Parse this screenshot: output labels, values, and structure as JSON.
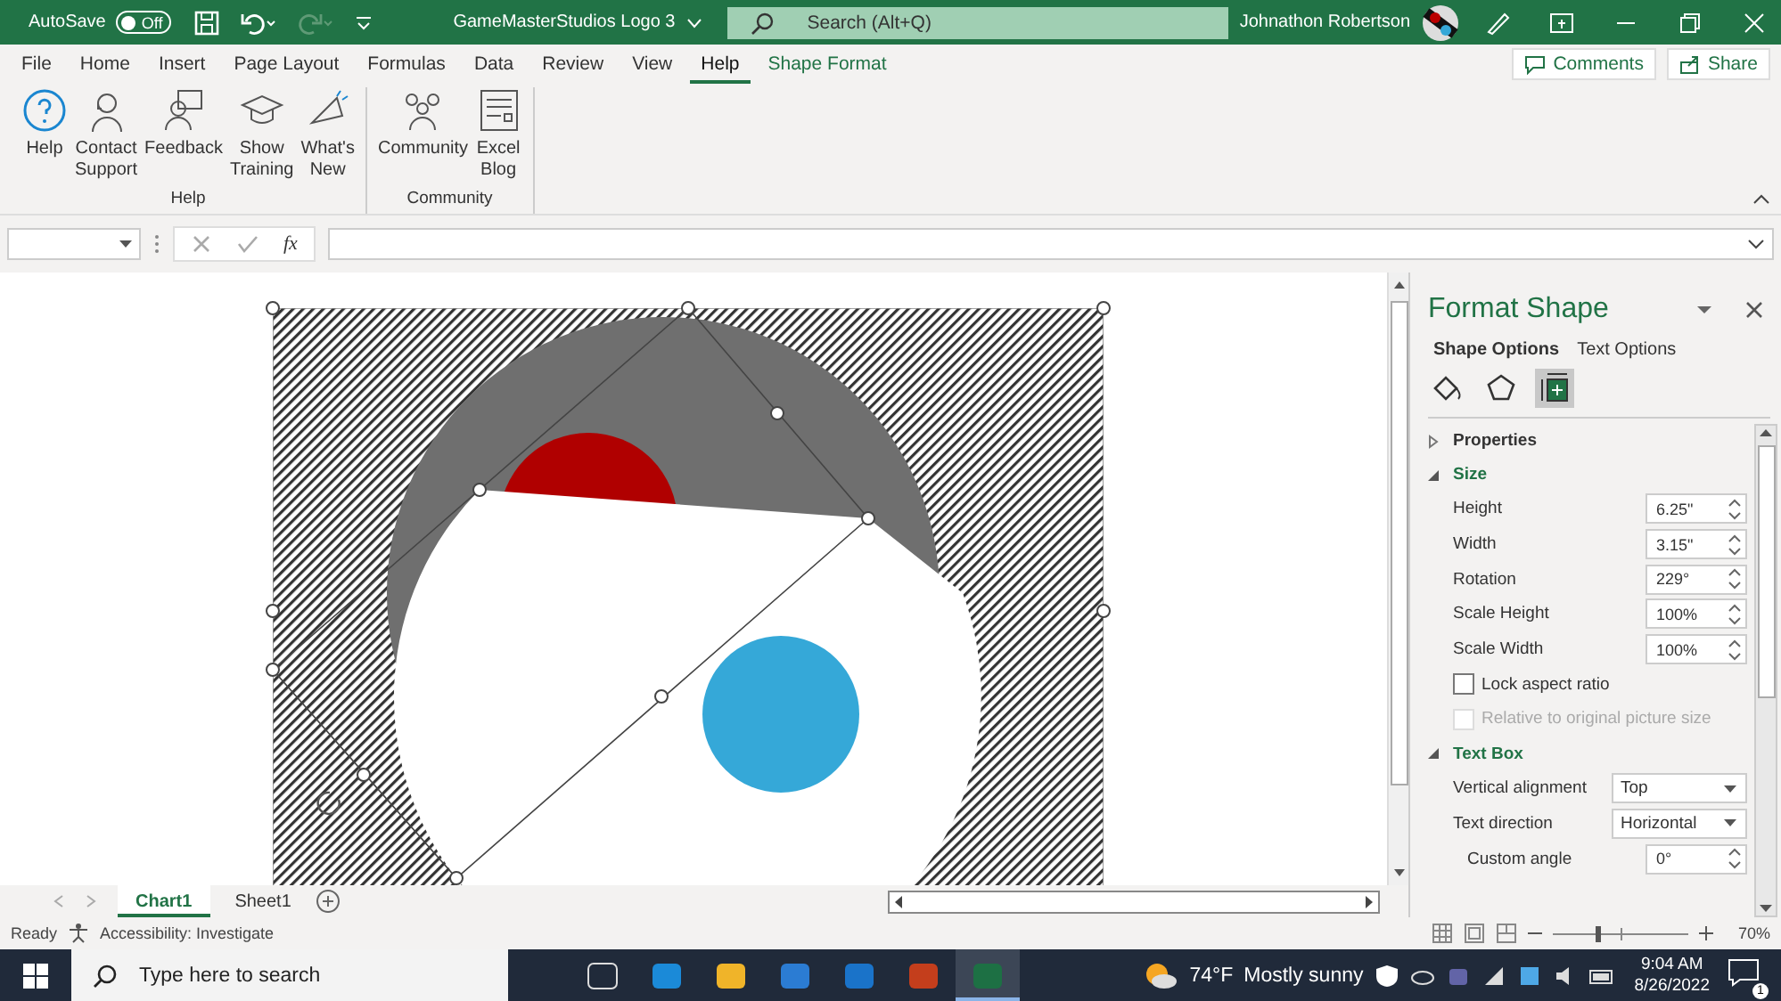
{
  "title_bar": {
    "autosave_label": "AutoSave",
    "autosave_toggle": {
      "label": "Off",
      "on": false
    },
    "document_title": "GameMasterStudios Logo 3",
    "search": {
      "placeholder": "Search (Alt+Q)"
    },
    "user_name": "Johnathon Robertson"
  },
  "ribbon_tabs": [
    {
      "label": "File",
      "selected": false,
      "kind": "standard"
    },
    {
      "label": "Home",
      "selected": false,
      "kind": "standard"
    },
    {
      "label": "Insert",
      "selected": false,
      "kind": "standard"
    },
    {
      "label": "Page Layout",
      "selected": false,
      "kind": "standard"
    },
    {
      "label": "Formulas",
      "selected": false,
      "kind": "standard"
    },
    {
      "label": "Data",
      "selected": false,
      "kind": "standard"
    },
    {
      "label": "Review",
      "selected": false,
      "kind": "standard"
    },
    {
      "label": "View",
      "selected": false,
      "kind": "standard"
    },
    {
      "label": "Help",
      "selected": true,
      "kind": "standard"
    },
    {
      "label": "Shape Format",
      "selected": false,
      "kind": "contextual"
    }
  ],
  "ribbon_actions": [
    "Comments",
    "Share"
  ],
  "ribbon_groups": [
    {
      "name": "Help",
      "buttons": [
        {
          "lines": [
            "Help"
          ]
        },
        {
          "lines": [
            "Contact",
            "Support"
          ]
        },
        {
          "lines": [
            "Feedback"
          ]
        },
        {
          "lines": [
            "Show",
            "Training"
          ]
        },
        {
          "lines": [
            "What's",
            "New"
          ]
        }
      ]
    },
    {
      "name": "Community",
      "buttons": [
        {
          "lines": [
            "Community"
          ]
        },
        {
          "lines": [
            "Excel",
            "Blog"
          ]
        }
      ]
    }
  ],
  "formula_bar": {
    "function_label": "fx"
  },
  "format_panel": {
    "title": "Format Shape",
    "tabs": [
      {
        "label": "Shape Options",
        "selected": true
      },
      {
        "label": "Text Options",
        "selected": false
      }
    ],
    "icon_tabs": [
      {
        "selected": false
      },
      {
        "selected": false
      },
      {
        "selected": true
      }
    ],
    "sections": [
      {
        "title": "Properties",
        "expanded": false
      },
      {
        "title": "Size",
        "expanded": true,
        "rows": [
          {
            "kind": "spin",
            "label": "Height",
            "value": "6.25\""
          },
          {
            "kind": "spin",
            "label": "Width",
            "value": "3.15\""
          },
          {
            "kind": "spin",
            "label": "Rotation",
            "value": "229°"
          },
          {
            "kind": "spin",
            "label": "Scale Height",
            "value": "100%"
          },
          {
            "kind": "spin",
            "label": "Scale Width",
            "value": "100%"
          },
          {
            "kind": "checkbox",
            "label": "Lock aspect ratio",
            "checked": false,
            "disabled": false
          },
          {
            "kind": "checkbox",
            "label": "Relative to original picture size",
            "checked": false,
            "disabled": true
          }
        ]
      },
      {
        "title": "Text Box",
        "expanded": true,
        "rows": [
          {
            "kind": "dropdown",
            "label": "Vertical alignment",
            "value": "Top"
          },
          {
            "kind": "dropdown",
            "label": "Text direction",
            "value": "Horizontal",
            "children": [
              {
                "kind": "spin",
                "label": "Custom angle",
                "value": "0°"
              }
            ]
          }
        ]
      }
    ]
  },
  "sheet_tabs": [
    {
      "label": "Chart1",
      "selected": true
    },
    {
      "label": "Sheet1",
      "selected": false
    }
  ],
  "status_bar": {
    "mode": "Ready",
    "accessibility": "Accessibility: Investigate",
    "zoom": {
      "level": 0.33,
      "reading": "70%"
    }
  },
  "taskbar": {
    "search": {
      "placeholder": "Type here to search"
    },
    "apps": [
      {
        "selected": false
      },
      {
        "selected": false
      },
      {
        "selected": false
      },
      {
        "selected": false
      },
      {
        "selected": false
      },
      {
        "selected": false
      },
      {
        "selected": true
      }
    ],
    "temperature": "74°F",
    "weather": "Mostly sunny",
    "time": "9:04 AM",
    "date": "8/26/2022",
    "notification_count": "1"
  }
}
